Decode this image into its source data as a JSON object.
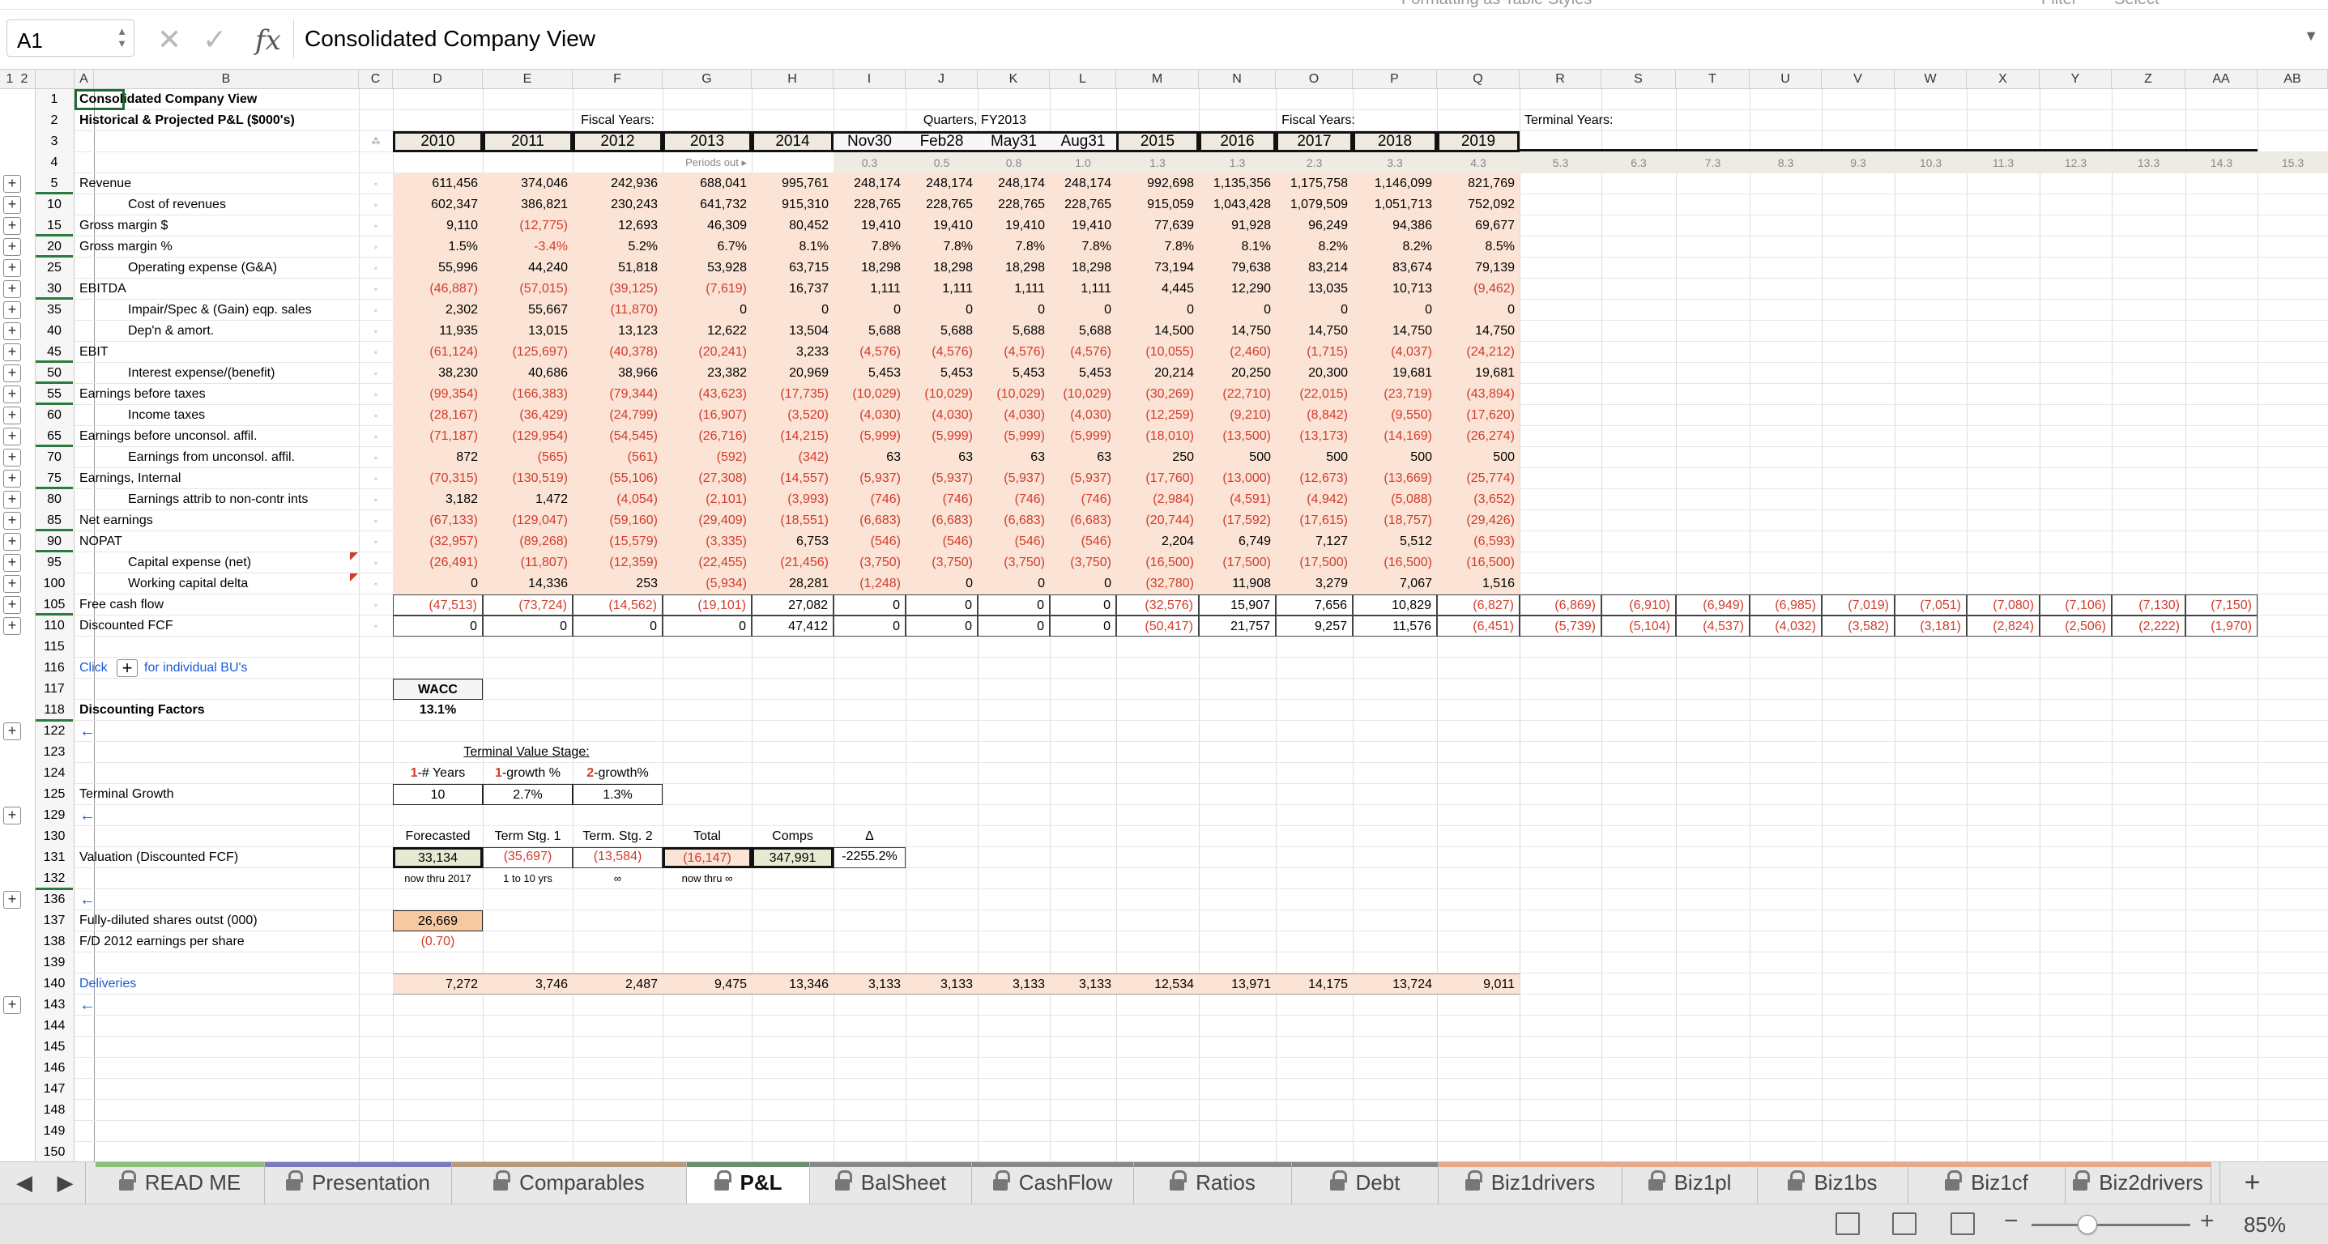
{
  "topbar": {
    "left": "Formatting   as Table   Styles",
    "right1": "Filter",
    "right2": "Select"
  },
  "formula_bar": {
    "cell_ref": "A1",
    "content": "Consolidated Company View",
    "fx": "fx"
  },
  "columns": [
    "A",
    "B",
    "C",
    "D",
    "E",
    "F",
    "G",
    "H",
    "I",
    "J",
    "K",
    "L",
    "M",
    "N",
    "O",
    "P",
    "Q",
    "R",
    "S",
    "T",
    "U",
    "V",
    "W",
    "X",
    "Y",
    "Z",
    "AA",
    "AB"
  ],
  "outline_levels": [
    "1",
    "2"
  ],
  "title": "Consolidated Company View",
  "subtitle": "Historical & Projected P&L ($000's)",
  "group_labels": {
    "fiscal1": "Fiscal Years:",
    "quarters": "Quarters, FY2013",
    "fiscal2": "Fiscal Years:",
    "terminal": "Terminal Years:"
  },
  "periods": [
    "2010",
    "2011",
    "2012",
    "2013",
    "2014",
    "Nov30",
    "Feb28",
    "May31",
    "Aug31",
    "2015",
    "2016",
    "2017",
    "2018",
    "2019"
  ],
  "periods_out_label": "Periods out ▸",
  "periods_out": [
    "0.3",
    "0.5",
    "0.8",
    "1.0",
    "1.3",
    "1.3",
    "2.3",
    "3.3",
    "4.3",
    "5.3",
    "6.3",
    "7.3",
    "8.3",
    "9.3",
    "10.3",
    "11.3",
    "12.3",
    "13.3",
    "14.3",
    "15.3"
  ],
  "rows": [
    {
      "num": "5",
      "label": "Revenue",
      "indent": false,
      "values": [
        "611,456",
        "374,046",
        "242,936",
        "688,041",
        "995,761",
        "248,174",
        "248,174",
        "248,174",
        "248,174",
        "992,698",
        "1,135,356",
        "1,175,758",
        "1,146,099",
        "821,769"
      ]
    },
    {
      "num": "10",
      "label": "Cost of revenues",
      "indent": true,
      "values": [
        "602,347",
        "386,821",
        "230,243",
        "641,732",
        "915,310",
        "228,765",
        "228,765",
        "228,765",
        "228,765",
        "915,059",
        "1,043,428",
        "1,079,509",
        "1,051,713",
        "752,092"
      ]
    },
    {
      "num": "15",
      "label": "Gross margin $",
      "indent": false,
      "values": [
        "9,110",
        "(12,775)",
        "12,693",
        "46,309",
        "80,452",
        "19,410",
        "19,410",
        "19,410",
        "19,410",
        "77,639",
        "91,928",
        "96,249",
        "94,386",
        "69,677"
      ]
    },
    {
      "num": "20",
      "label": "Gross margin %",
      "indent": false,
      "values": [
        "1.5%",
        "-3.4%",
        "5.2%",
        "6.7%",
        "8.1%",
        "7.8%",
        "7.8%",
        "7.8%",
        "7.8%",
        "7.8%",
        "8.1%",
        "8.2%",
        "8.2%",
        "8.5%"
      ]
    },
    {
      "num": "25",
      "label": "Operating expense (G&A)",
      "indent": true,
      "values": [
        "55,996",
        "44,240",
        "51,818",
        "53,928",
        "63,715",
        "18,298",
        "18,298",
        "18,298",
        "18,298",
        "73,194",
        "79,638",
        "83,214",
        "83,674",
        "79,139"
      ]
    },
    {
      "num": "30",
      "label": "EBITDA",
      "indent": false,
      "values": [
        "(46,887)",
        "(57,015)",
        "(39,125)",
        "(7,619)",
        "16,737",
        "1,111",
        "1,111",
        "1,111",
        "1,111",
        "4,445",
        "12,290",
        "13,035",
        "10,713",
        "(9,462)"
      ]
    },
    {
      "num": "35",
      "label": "Impair/Spec & (Gain) eqp. sales",
      "indent": true,
      "values": [
        "2,302",
        "55,667",
        "(11,870)",
        "0",
        "0",
        "0",
        "0",
        "0",
        "0",
        "0",
        "0",
        "0",
        "0",
        "0"
      ]
    },
    {
      "num": "40",
      "label": "Dep'n & amort.",
      "indent": true,
      "values": [
        "11,935",
        "13,015",
        "13,123",
        "12,622",
        "13,504",
        "5,688",
        "5,688",
        "5,688",
        "5,688",
        "14,500",
        "14,750",
        "14,750",
        "14,750",
        "14,750"
      ]
    },
    {
      "num": "45",
      "label": "EBIT",
      "indent": false,
      "values": [
        "(61,124)",
        "(125,697)",
        "(40,378)",
        "(20,241)",
        "3,233",
        "(4,576)",
        "(4,576)",
        "(4,576)",
        "(4,576)",
        "(10,055)",
        "(2,460)",
        "(1,715)",
        "(4,037)",
        "(24,212)"
      ]
    },
    {
      "num": "50",
      "label": "Interest expense/(benefit)",
      "indent": true,
      "values": [
        "38,230",
        "40,686",
        "38,966",
        "23,382",
        "20,969",
        "5,453",
        "5,453",
        "5,453",
        "5,453",
        "20,214",
        "20,250",
        "20,300",
        "19,681",
        "19,681"
      ]
    },
    {
      "num": "55",
      "label": "Earnings before taxes",
      "indent": false,
      "values": [
        "(99,354)",
        "(166,383)",
        "(79,344)",
        "(43,623)",
        "(17,735)",
        "(10,029)",
        "(10,029)",
        "(10,029)",
        "(10,029)",
        "(30,269)",
        "(22,710)",
        "(22,015)",
        "(23,719)",
        "(43,894)"
      ]
    },
    {
      "num": "60",
      "label": "Income taxes",
      "indent": true,
      "values": [
        "(28,167)",
        "(36,429)",
        "(24,799)",
        "(16,907)",
        "(3,520)",
        "(4,030)",
        "(4,030)",
        "(4,030)",
        "(4,030)",
        "(12,259)",
        "(9,210)",
        "(8,842)",
        "(9,550)",
        "(17,620)"
      ]
    },
    {
      "num": "65",
      "label": "Earnings before unconsol. affil.",
      "indent": false,
      "values": [
        "(71,187)",
        "(129,954)",
        "(54,545)",
        "(26,716)",
        "(14,215)",
        "(5,999)",
        "(5,999)",
        "(5,999)",
        "(5,999)",
        "(18,010)",
        "(13,500)",
        "(13,173)",
        "(14,169)",
        "(26,274)"
      ]
    },
    {
      "num": "70",
      "label": "Earnings from unconsol. affil.",
      "indent": true,
      "values": [
        "872",
        "(565)",
        "(561)",
        "(592)",
        "(342)",
        "63",
        "63",
        "63",
        "63",
        "250",
        "500",
        "500",
        "500",
        "500"
      ]
    },
    {
      "num": "75",
      "label": "Earnings, Internal",
      "indent": false,
      "values": [
        "(70,315)",
        "(130,519)",
        "(55,106)",
        "(27,308)",
        "(14,557)",
        "(5,937)",
        "(5,937)",
        "(5,937)",
        "(5,937)",
        "(17,760)",
        "(13,000)",
        "(12,673)",
        "(13,669)",
        "(25,774)"
      ]
    },
    {
      "num": "80",
      "label": "Earnings attrib to non-contr ints",
      "indent": true,
      "values": [
        "3,182",
        "1,472",
        "(4,054)",
        "(2,101)",
        "(3,993)",
        "(746)",
        "(746)",
        "(746)",
        "(746)",
        "(2,984)",
        "(4,591)",
        "(4,942)",
        "(5,088)",
        "(3,652)"
      ]
    },
    {
      "num": "85",
      "label": "Net earnings",
      "indent": false,
      "values": [
        "(67,133)",
        "(129,047)",
        "(59,160)",
        "(29,409)",
        "(18,551)",
        "(6,683)",
        "(6,683)",
        "(6,683)",
        "(6,683)",
        "(20,744)",
        "(17,592)",
        "(17,615)",
        "(18,757)",
        "(29,426)"
      ]
    },
    {
      "num": "90",
      "label": "NOPAT",
      "indent": false,
      "values": [
        "(32,957)",
        "(89,268)",
        "(15,579)",
        "(3,335)",
        "6,753",
        "(546)",
        "(546)",
        "(546)",
        "(546)",
        "2,204",
        "6,749",
        "7,127",
        "5,512",
        "(6,593)"
      ]
    },
    {
      "num": "95",
      "label": "Capital expense (net)",
      "indent": true,
      "values": [
        "(26,491)",
        "(11,807)",
        "(12,359)",
        "(22,455)",
        "(21,456)",
        "(3,750)",
        "(3,750)",
        "(3,750)",
        "(3,750)",
        "(16,500)",
        "(17,500)",
        "(17,500)",
        "(16,500)",
        "(16,500)"
      ]
    },
    {
      "num": "100",
      "label": "Working capital delta",
      "indent": true,
      "values": [
        "0",
        "14,336",
        "253",
        "(5,934)",
        "28,281",
        "(1,248)",
        "0",
        "0",
        "0",
        "(32,780)",
        "11,908",
        "3,279",
        "7,067",
        "1,516"
      ]
    },
    {
      "num": "105",
      "label": "Free cash flow",
      "indent": false,
      "values": [
        "(47,513)",
        "(73,724)",
        "(14,562)",
        "(19,101)",
        "27,082",
        "0",
        "0",
        "0",
        "0",
        "(32,576)",
        "15,907",
        "7,656",
        "10,829",
        "(6,827)"
      ],
      "terminal": [
        "(6,869)",
        "(6,910)",
        "(6,949)",
        "(6,985)",
        "(7,019)",
        "(7,051)",
        "(7,080)",
        "(7,106)",
        "(7,130)",
        "(7,150)"
      ]
    },
    {
      "num": "110",
      "label": "Discounted FCF",
      "indent": false,
      "values": [
        "0",
        "0",
        "0",
        "0",
        "47,412",
        "0",
        "0",
        "0",
        "0",
        "(50,417)",
        "21,757",
        "9,257",
        "11,576",
        "(6,451)"
      ],
      "terminal": [
        "(5,739)",
        "(5,104)",
        "(4,537)",
        "(4,032)",
        "(3,582)",
        "(3,181)",
        "(2,824)",
        "(2,506)",
        "(2,222)",
        "(1,970)"
      ]
    }
  ],
  "lower_rows": [
    "115",
    "116",
    "117",
    "118",
    "122",
    "123",
    "124",
    "125",
    "129",
    "130",
    "131",
    "132",
    "136",
    "137",
    "138",
    "139",
    "140",
    "143",
    "144",
    "145",
    "146",
    "147",
    "148",
    "149",
    "150"
  ],
  "lower": {
    "click_text": "Click",
    "bu_text": "for individual BU's",
    "wacc_label": "WACC",
    "wacc_value": "13.1%",
    "discounting_factors": "Discounting Factors",
    "back_arrow": "←",
    "terminal_stage": "Terminal Value Stage:",
    "stage_headers": [
      {
        "num": "1",
        "text": "-# Years"
      },
      {
        "num": "1",
        "text": "-growth %"
      },
      {
        "num": "2",
        "text": "-growth%"
      }
    ],
    "terminal_growth_label": "Terminal Growth",
    "terminal_growth": [
      "10",
      "2.7%",
      "1.3%"
    ],
    "val_headers": [
      "Forecasted",
      "Term Stg. 1",
      "Term. Stg. 2",
      "Total",
      "Comps",
      "Δ"
    ],
    "valuation_label": "Valuation (Discounted FCF)",
    "valuation": [
      "33,134",
      "(35,697)",
      "(13,584)",
      "(16,147)",
      "347,991",
      "-2255.2%"
    ],
    "val_notes": [
      "now thru 2017",
      "1 to 10 yrs",
      "∞",
      "now thru ∞"
    ],
    "shares_label": "Fully-diluted shares outst (000)",
    "shares_value": "26,669",
    "eps_label": "F/D 2012 earnings per share",
    "eps_value": "(0.70)",
    "deliveries_label": "Deliveries",
    "deliveries": [
      "7,272",
      "3,746",
      "2,487",
      "9,475",
      "13,346",
      "3,133",
      "3,133",
      "3,133",
      "3,133",
      "12,534",
      "13,971",
      "14,175",
      "13,724",
      "9,011"
    ]
  },
  "sheet_tabs": [
    {
      "label": "READ ME",
      "color": "#8cbf7a"
    },
    {
      "label": "Presentation",
      "color": "#7a7abf"
    },
    {
      "label": "Comparables",
      "color": "#b89a7a"
    },
    {
      "label": "P&L",
      "color": "#6a8f6a",
      "active": true
    },
    {
      "label": "BalSheet",
      "color": "#888888"
    },
    {
      "label": "CashFlow",
      "color": "#888888"
    },
    {
      "label": "Ratios",
      "color": "#888888"
    },
    {
      "label": "Debt",
      "color": "#888888"
    },
    {
      "label": "Biz1drivers",
      "color": "#e8a889"
    },
    {
      "label": "Biz1pl",
      "color": "#e8a889"
    },
    {
      "label": "Biz1bs",
      "color": "#e8a889"
    },
    {
      "label": "Biz1cf",
      "color": "#e8a889"
    },
    {
      "label": "Biz2drivers",
      "color": "#e8a889"
    }
  ],
  "add_sheet": "+",
  "zoom": "85%",
  "zoom_fraction": 0.35
}
